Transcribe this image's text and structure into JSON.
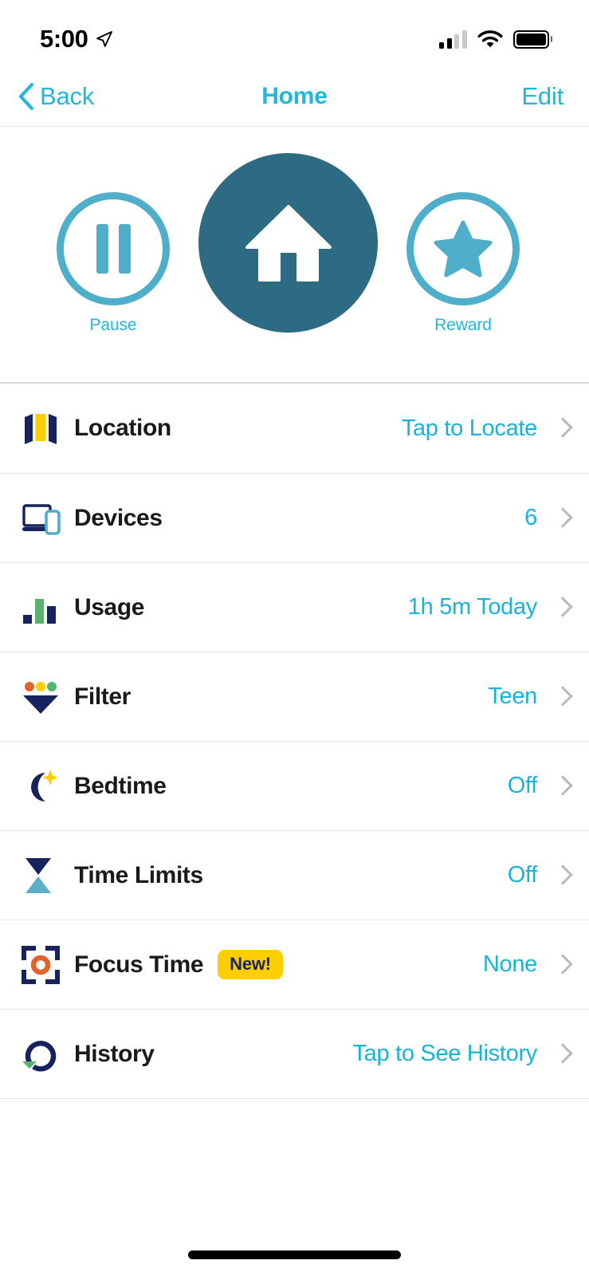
{
  "status_bar": {
    "time": "5:00",
    "location_icon": "location-arrow-icon",
    "signal_icon": "cellular-signal-icon",
    "wifi_icon": "wifi-icon",
    "battery_icon": "battery-full-icon"
  },
  "nav": {
    "back_label": "Back",
    "back_icon": "chevron-left-icon",
    "title": "Home",
    "edit_label": "Edit"
  },
  "hero": {
    "pause_label": "Pause",
    "pause_icon": "pause-icon",
    "home_icon": "home-icon",
    "reward_label": "Reward",
    "reward_icon": "star-icon",
    "colors": {
      "ring": "#4FAEC9",
      "center_circle": "#2C6B81",
      "label": "#20B7DC"
    }
  },
  "list": {
    "rows": [
      {
        "icon": "map-icon",
        "label": "Location",
        "value": "Tap to Locate",
        "badge": null
      },
      {
        "icon": "devices-icon",
        "label": "Devices",
        "value": "6",
        "badge": null
      },
      {
        "icon": "bar-chart-icon",
        "label": "Usage",
        "value": "1h 5m Today",
        "badge": null
      },
      {
        "icon": "funnel-icon",
        "label": "Filter",
        "value": "Teen",
        "badge": null
      },
      {
        "icon": "moon-icon",
        "label": "Bedtime",
        "value": "Off",
        "badge": null
      },
      {
        "icon": "hourglass-icon",
        "label": "Time Limits",
        "value": "Off",
        "badge": null
      },
      {
        "icon": "focus-icon",
        "label": "Focus Time",
        "value": "None",
        "badge": "New!"
      },
      {
        "icon": "history-icon",
        "label": "History",
        "value": "Tap to See History",
        "badge": null
      }
    ]
  },
  "colors": {
    "accent_cyan": "#17B3D8",
    "navy": "#17235E",
    "teal_dark": "#2C6B81",
    "teal_light": "#4FAEC9",
    "yellow": "#FFCE00",
    "green": "#57B36E",
    "orange": "#E2622A",
    "chevron_gray": "#b9b9bd"
  },
  "home_indicator": "home-indicator-bar"
}
